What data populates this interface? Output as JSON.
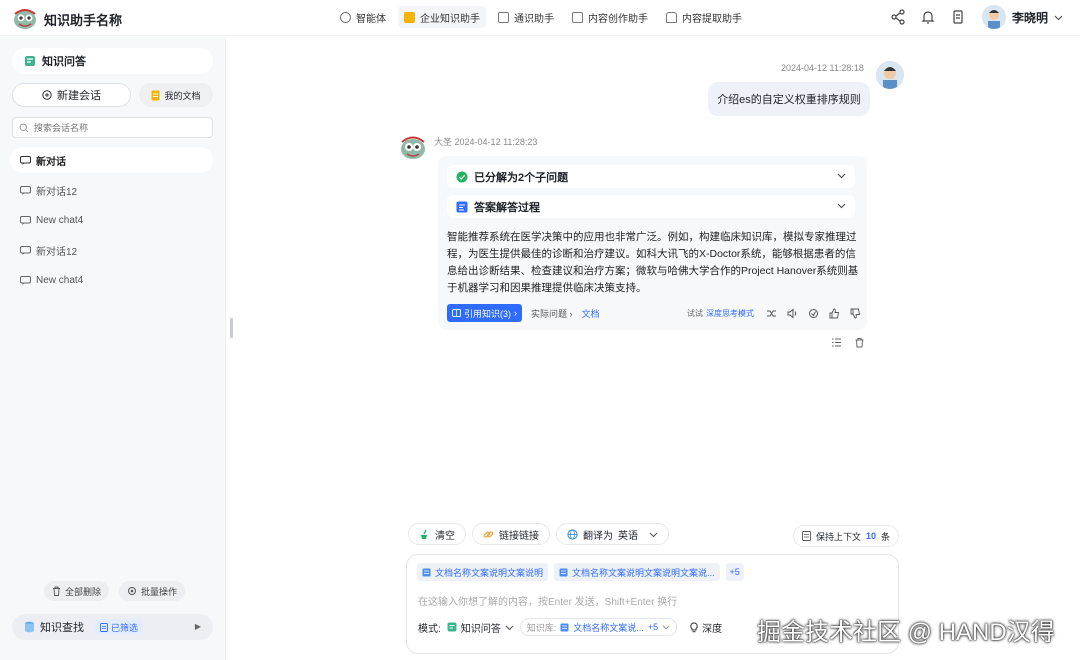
{
  "app": {
    "title": "知识助手名称"
  },
  "nav": [
    {
      "label": "智能体",
      "icon": "agent-icon"
    },
    {
      "label": "企业知识助手",
      "icon": "enterprise-kb-icon"
    },
    {
      "label": "通识助手",
      "icon": "general-assistant-icon"
    },
    {
      "label": "内容创作助手",
      "icon": "content-creation-icon"
    },
    {
      "label": "内容提取助手",
      "icon": "content-extract-icon"
    }
  ],
  "user": {
    "name": "李晓明"
  },
  "sidebar": {
    "header": "知识问答",
    "new_chat": "新建会话",
    "my_docs": "我的文档",
    "search_placeholder": "搜索会话名称",
    "conversations": [
      "新对话",
      "新对话12",
      "New chat4",
      "新对话12",
      "New chat4"
    ],
    "delete_all": "全部删除",
    "batch_ops": "批量操作",
    "kb_find": "知识查找",
    "filtered": "已筛选"
  },
  "chat": {
    "user_time": "2024-04-12 11:28:18",
    "user_msg": "介绍es的自定义权重排序规则",
    "bot_name": "大圣",
    "bot_time": "2024-04-12 11:28:23",
    "step1": "已分解为2个子问题",
    "step2": "答案解答过程",
    "answer": "智能推荐系统在医学决策中的应用也非常广泛。例如，构建临床知识库，模拟专家推理过程，为医生提供最佳的诊断和治疗建议。如科大讯飞的X-Doctor系统，能够根据患者的信息给出诊断结果、检查建议和治疗方案；微软与哈佛大学合作的Project Hanover系统则基于机器学习和因果推理提供临床决策支持。",
    "cite_label": "引用知识(3)",
    "real_q": "实际问题",
    "doc_link": "文档",
    "try_prefix": "试试",
    "try_mode": "深度思考模式"
  },
  "toolbar": {
    "clear": "清空",
    "link": "链接链接",
    "translate_prefix": "翻译为",
    "translate_lang": "英语",
    "context_prefix": "保持上下文",
    "context_count": "10",
    "context_unit": "条"
  },
  "input": {
    "chips": [
      "文档名称文案说明文案说明",
      "文档名称文案说明文案说明文案说..."
    ],
    "chips_more": "+5",
    "placeholder": "在这输入你想了解的内容，按Enter 发送，Shift+Enter 换行",
    "mode_label": "模式:",
    "mode_value": "知识问答",
    "kb_label": "知识库:",
    "kb_doc": "文档名称文案说...",
    "kb_more": "+5",
    "deep": "深度"
  },
  "watermark": "掘金技术社区 @ HAND汉得",
  "colors": {
    "accent": "#2f6bff",
    "success": "#22b35e",
    "sidebar_bg": "#f7f8fa"
  }
}
